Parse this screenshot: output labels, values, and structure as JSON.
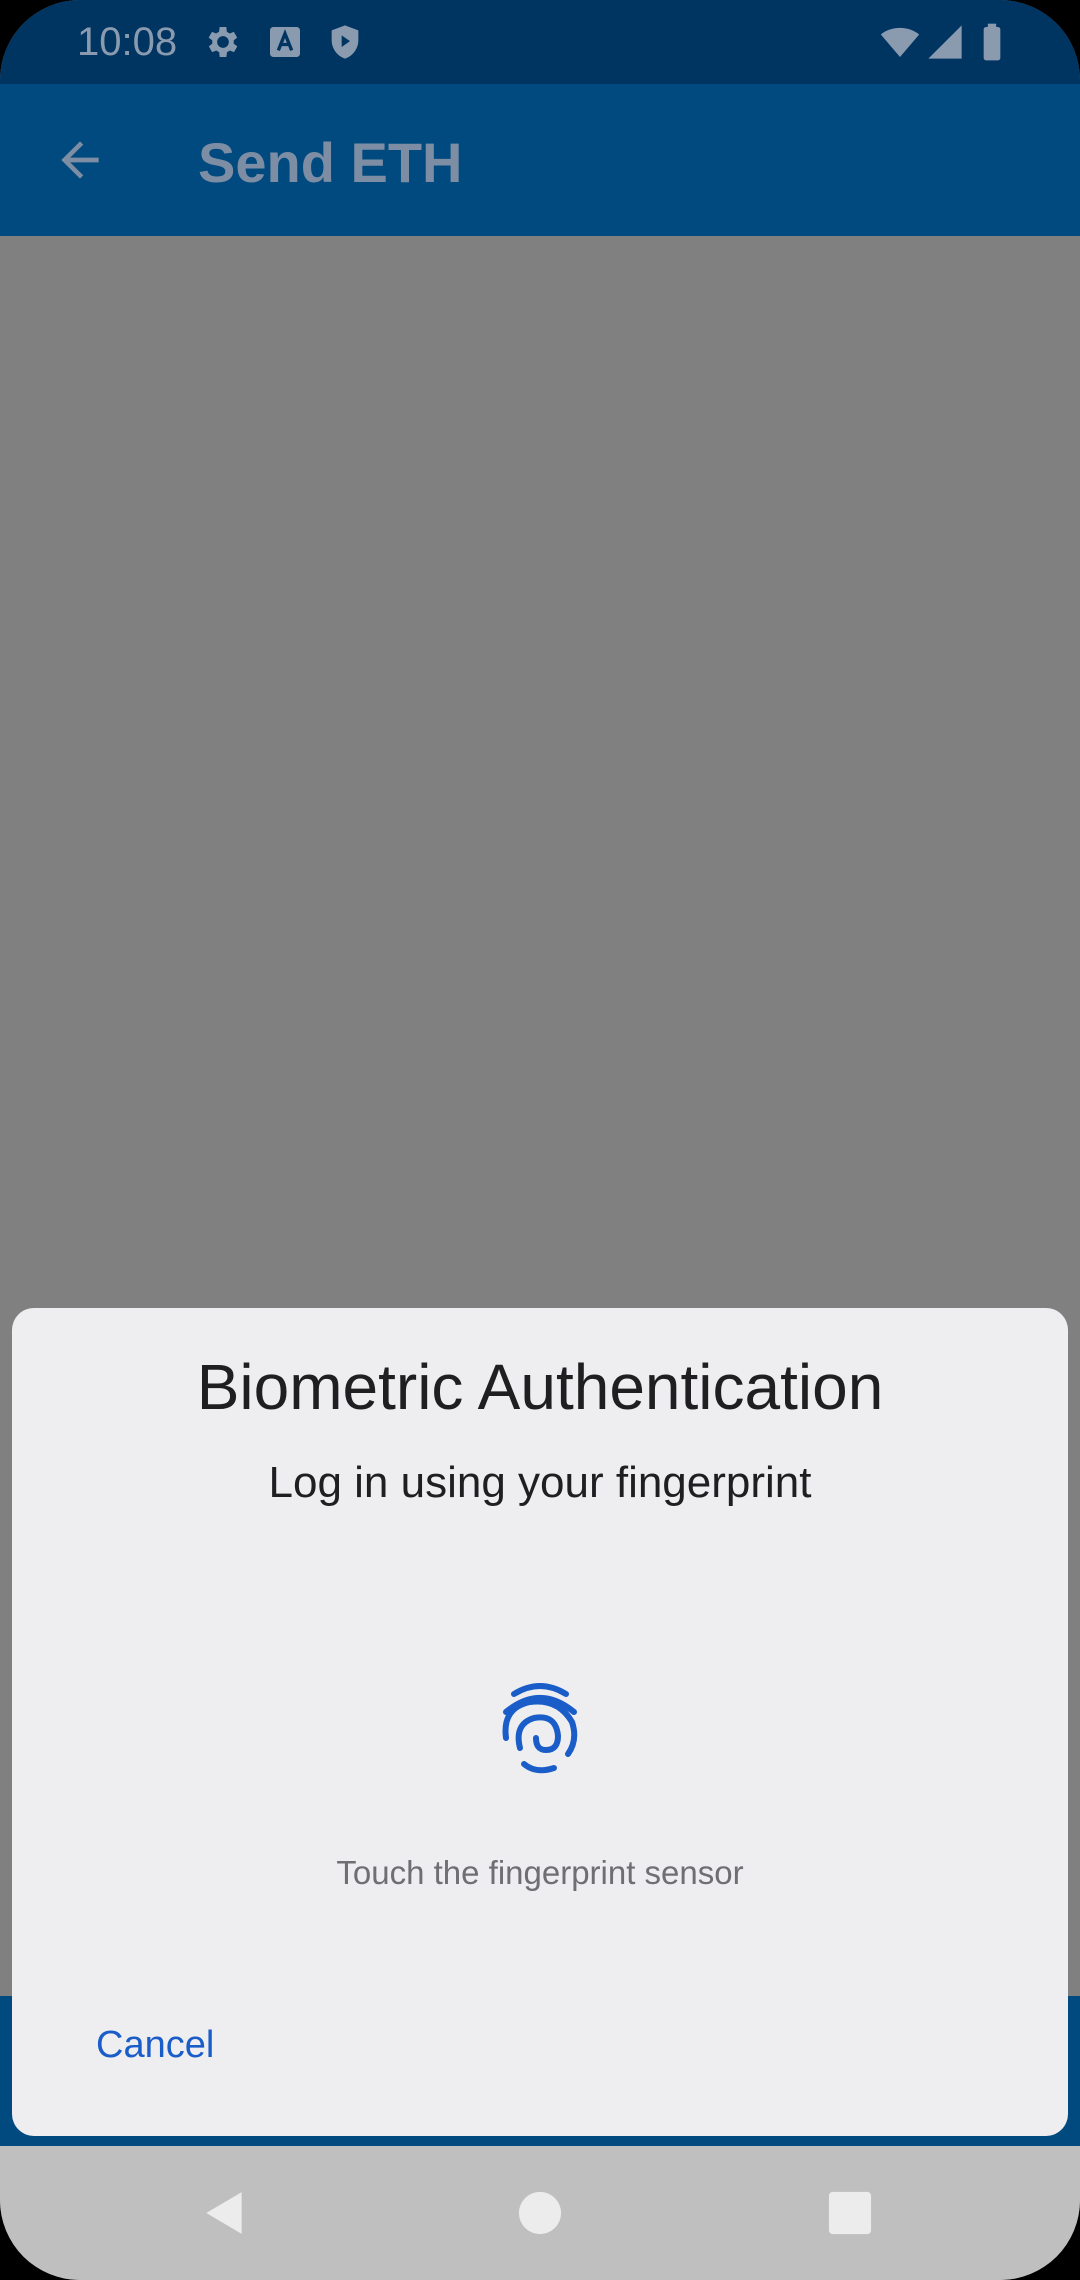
{
  "status_bar": {
    "time": "10:08",
    "left_icons": [
      "gear-icon",
      "text-a-icon",
      "shield-play-icon"
    ],
    "right_icons": [
      "wifi-icon",
      "signal-icon",
      "battery-icon"
    ]
  },
  "app_bar": {
    "title": "Send ETH",
    "back_icon": "arrow-back-icon"
  },
  "dialog": {
    "title": "Biometric Authentication",
    "subtitle": "Log in using your fingerprint",
    "icon": "fingerprint-icon",
    "hint": "Touch the fingerprint sensor",
    "cancel_label": "Cancel"
  },
  "nav_bar": {
    "icons": [
      "back-triangle-icon",
      "home-circle-icon",
      "recents-square-icon"
    ]
  },
  "colors": {
    "status_bar": "#003461",
    "app_bar": "#004a7f",
    "scrim": "#808080",
    "dialog_bg": "#eeeef1",
    "accent": "#1a5dc8",
    "nav_bar": "#bfbfbf"
  }
}
